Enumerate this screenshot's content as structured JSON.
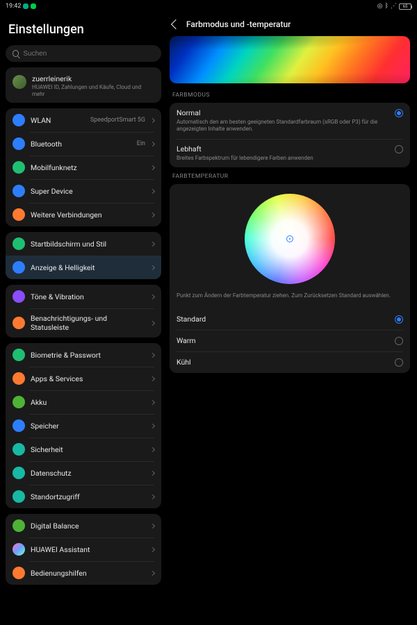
{
  "status": {
    "time": "19:42",
    "battery": "65"
  },
  "sidebar": {
    "title": "Einstellungen",
    "search_placeholder": "Suchen",
    "account": {
      "name": "zuerrleinerik",
      "sub": "HUAWEI ID, Zahlungen und Käufe, Cloud und mehr"
    },
    "g1": [
      {
        "label": "WLAN",
        "value": "SpeedportSmart 5G",
        "color": "#2d7eff"
      },
      {
        "label": "Bluetooth",
        "value": "Ein",
        "color": "#2d7eff"
      },
      {
        "label": "Mobilfunknetz",
        "value": "",
        "color": "#1fbf72"
      },
      {
        "label": "Super Device",
        "value": "",
        "color": "#2d7eff"
      },
      {
        "label": "Weitere Verbindungen",
        "value": "",
        "color": "#ff7a30"
      }
    ],
    "g2": [
      {
        "label": "Startbildschirm und Stil",
        "color": "#1fbf72"
      },
      {
        "label": "Anzeige & Helligkeit",
        "color": "#2d7eff",
        "selected": true
      }
    ],
    "g3": [
      {
        "label": "Töne & Vibration",
        "color": "#8a4dff"
      },
      {
        "label": "Benachrichtigungs- und Statusleiste",
        "color": "#ff7a30"
      }
    ],
    "g4": [
      {
        "label": "Biometrie & Passwort",
        "color": "#1fbf72"
      },
      {
        "label": "Apps & Services",
        "color": "#ff7a30"
      },
      {
        "label": "Akku",
        "color": "#4db336"
      },
      {
        "label": "Speicher",
        "color": "#2d7eff"
      },
      {
        "label": "Sicherheit",
        "color": "#17b9a5"
      },
      {
        "label": "Datenschutz",
        "color": "#17b9a5"
      },
      {
        "label": "Standortzugriff",
        "color": "#17b9a5"
      }
    ],
    "g5": [
      {
        "label": "Digital Balance",
        "color": "#4db336"
      },
      {
        "label": "HUAWEI Assistant",
        "gradient": true
      },
      {
        "label": "Bedienungshilfen",
        "color": "#ff7a30"
      }
    ]
  },
  "content": {
    "title": "Farbmodus und -temperatur",
    "mode_section": "FARBMODUS",
    "modes": [
      {
        "title": "Normal",
        "desc": "Automatisch den am besten geeigneten Standardfarbraum (sRGB oder P3) für die angezeigten Inhalte anwenden.",
        "checked": true
      },
      {
        "title": "Lebhaft",
        "desc": "Breites Farbspektrum für lebendigere Farben anwenden",
        "checked": false
      }
    ],
    "temp_section": "FARBTEMPERATUR",
    "wheel_hint": "Punkt zum Ändern der Farbtemperatur ziehen. Zum Zurücksetzen Standard auswählen.",
    "temps": [
      {
        "label": "Standard",
        "checked": true
      },
      {
        "label": "Warm",
        "checked": false
      },
      {
        "label": "Kühl",
        "checked": false
      }
    ]
  }
}
